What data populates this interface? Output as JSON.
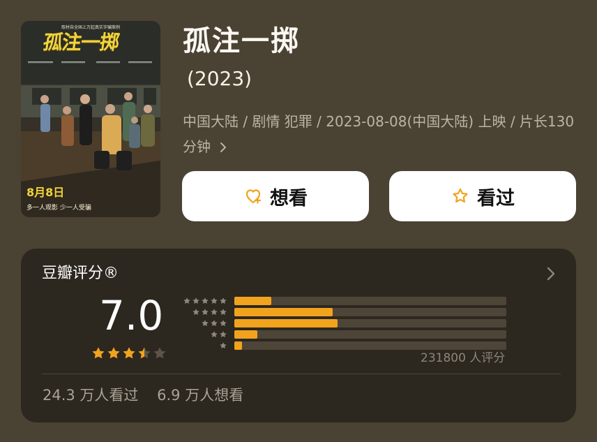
{
  "movie": {
    "title": "孤注一掷",
    "year": "(2023)",
    "meta": "中国大陆 / 剧情 犯罪 / 2023-08-08(中国大陆) 上映 / 片长130 分钟"
  },
  "poster": {
    "top_text": "取材自全国上万起真实诈骗案例",
    "title": "孤注一掷",
    "release_text": "8月8日",
    "tagline": "多一人观影 少一人受骗",
    "icon": "poster-image"
  },
  "actions": {
    "want": {
      "label": "想看",
      "icon": "heart-plus-icon"
    },
    "watched": {
      "label": "看过",
      "icon": "star-outline-icon"
    }
  },
  "rating": {
    "heading": "豆瓣评分®",
    "score": "7.0",
    "summary_stars": 3.5,
    "ratings_count": "231800 人评分",
    "distribution": [
      {
        "stars": 5,
        "value": 0.136
      },
      {
        "stars": 4,
        "value": 0.361
      },
      {
        "stars": 3,
        "value": 0.38
      },
      {
        "stars": 2,
        "value": 0.084
      },
      {
        "stars": 1,
        "value": 0.028
      }
    ],
    "watched": "24.3 万人看过",
    "want_to_watch": "6.9 万人想看",
    "chevron_icon": "chevron-right-icon"
  },
  "colors": {
    "page_bg": "#4a4232",
    "card_bg": "#2c271f",
    "accent": "#f2a31d",
    "text_primary": "#ffffff",
    "text_secondary": "#bdb4a4",
    "text_muted": "#8e8578"
  }
}
